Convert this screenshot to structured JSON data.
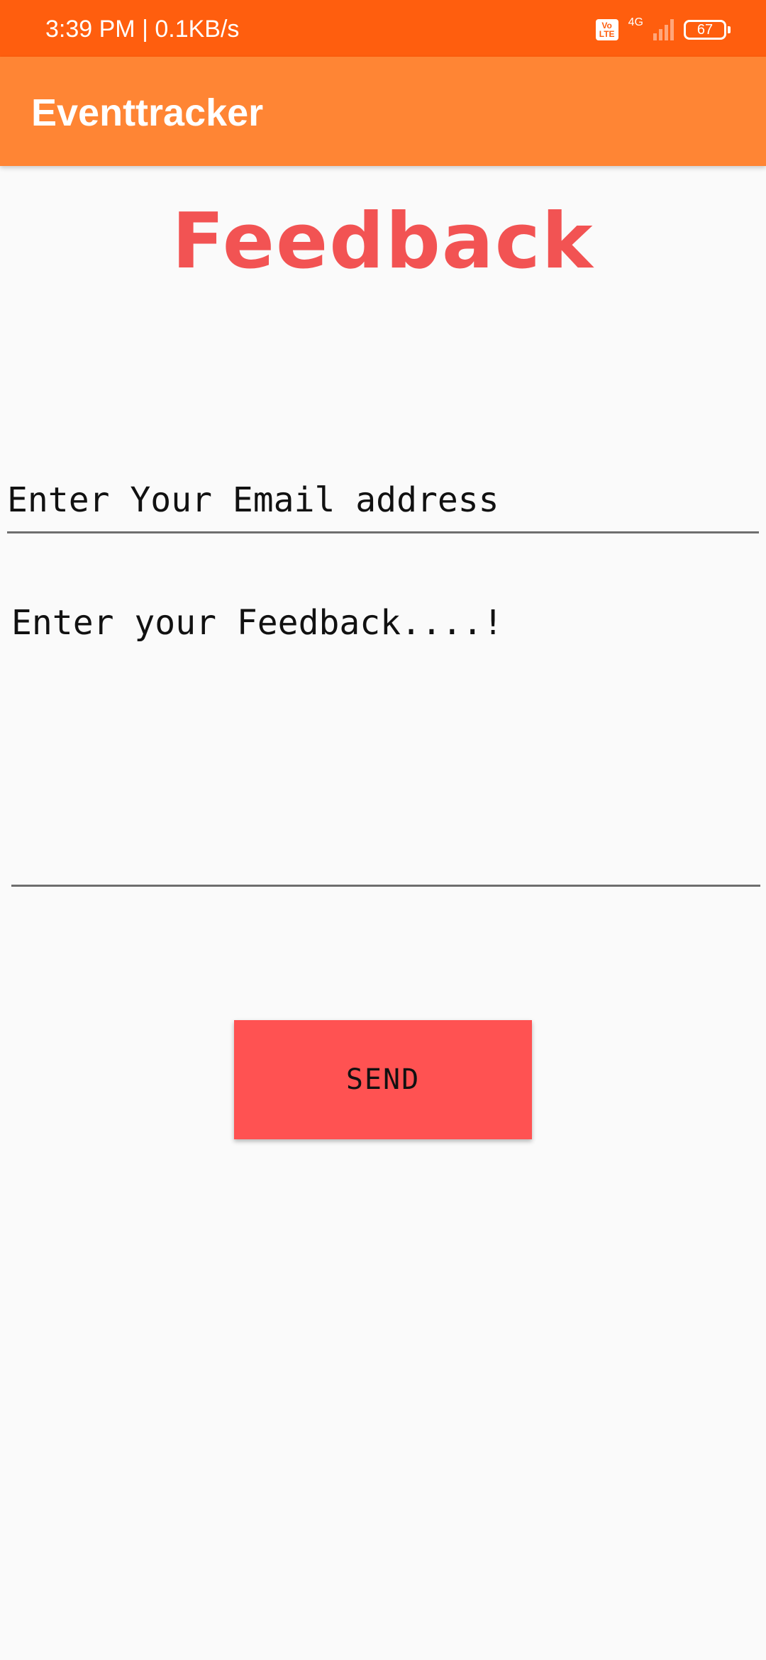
{
  "status_bar": {
    "time_text": "3:39 PM | 0.1KB/s",
    "volte_line1": "Vo",
    "volte_line2": "LTE",
    "network_type": "4G",
    "signal_bars_filled": 0,
    "signal_bars_total": 4,
    "battery_level": "67",
    "background_color": "#FF5E0E"
  },
  "app_bar": {
    "title": "Eventtracker",
    "background_color": "#FF8534"
  },
  "main": {
    "page_title": "Feedback",
    "title_color": "#F25353",
    "email_input": {
      "placeholder": "Enter Your Email address",
      "value": ""
    },
    "feedback_input": {
      "placeholder": "Enter your Feedback....!",
      "value": ""
    },
    "send_button": {
      "label": "SEND",
      "color": "#FF5252"
    }
  }
}
